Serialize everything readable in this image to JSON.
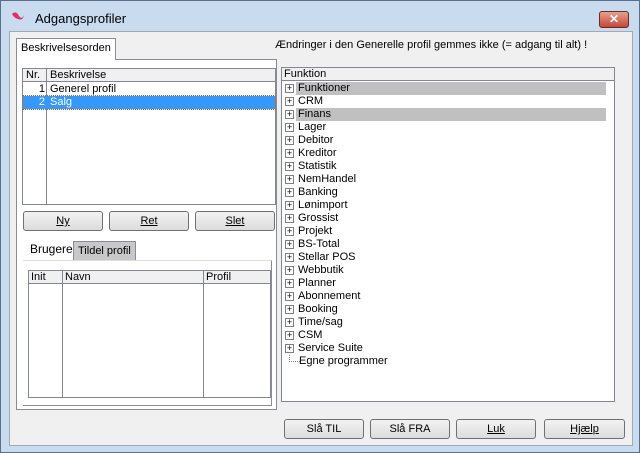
{
  "window": {
    "title": "Adgangsprofiler",
    "close_icon": "close-icon"
  },
  "notice": "Ændringer i den Generelle profil gemmes ikke (= adgang til alt) !",
  "left_tab": "Beskrivelsesorden",
  "profiles": {
    "headers": [
      "Nr.",
      "Beskrivelse"
    ],
    "rows": [
      {
        "nr": "1",
        "desc": "Generel profil"
      },
      {
        "nr": "2",
        "desc": "Salg",
        "selected": true
      }
    ]
  },
  "profile_buttons": {
    "new": "Ny",
    "edit": "Ret",
    "delete": "Slet"
  },
  "user_tabs": [
    "Brugere",
    "Tildel profil"
  ],
  "users": {
    "headers": [
      "Init",
      "Navn",
      "Profil"
    ],
    "rows": []
  },
  "tree": {
    "header": "Funktion",
    "items": [
      {
        "label": "Funktioner",
        "expandable": true,
        "highlight": true
      },
      {
        "label": "CRM",
        "expandable": true
      },
      {
        "label": "Finans",
        "expandable": true,
        "highlight": true
      },
      {
        "label": "Lager",
        "expandable": true
      },
      {
        "label": "Debitor",
        "expandable": true
      },
      {
        "label": "Kreditor",
        "expandable": true
      },
      {
        "label": "Statistik",
        "expandable": true
      },
      {
        "label": "NemHandel",
        "expandable": true
      },
      {
        "label": "Banking",
        "expandable": true
      },
      {
        "label": "Lønimport",
        "expandable": true
      },
      {
        "label": "Grossist",
        "expandable": true
      },
      {
        "label": "Projekt",
        "expandable": true
      },
      {
        "label": "BS-Total",
        "expandable": true
      },
      {
        "label": "Stellar POS",
        "expandable": true
      },
      {
        "label": "Webbutik",
        "expandable": true
      },
      {
        "label": "Planner",
        "expandable": true
      },
      {
        "label": "Abonnement",
        "expandable": true
      },
      {
        "label": "Booking",
        "expandable": true
      },
      {
        "label": "Time/sag",
        "expandable": true
      },
      {
        "label": "CSM",
        "expandable": true
      },
      {
        "label": "Service Suite",
        "expandable": true
      },
      {
        "label": "Egne programmer",
        "expandable": false
      }
    ]
  },
  "bottom_buttons": {
    "on": "Slå TIL",
    "off": "Slå FRA",
    "close": "Luk",
    "help": "Hjælp"
  },
  "colors": {
    "selection": "#3399ff",
    "highlight": "#c0c0c0",
    "accent": "#e0306a"
  }
}
